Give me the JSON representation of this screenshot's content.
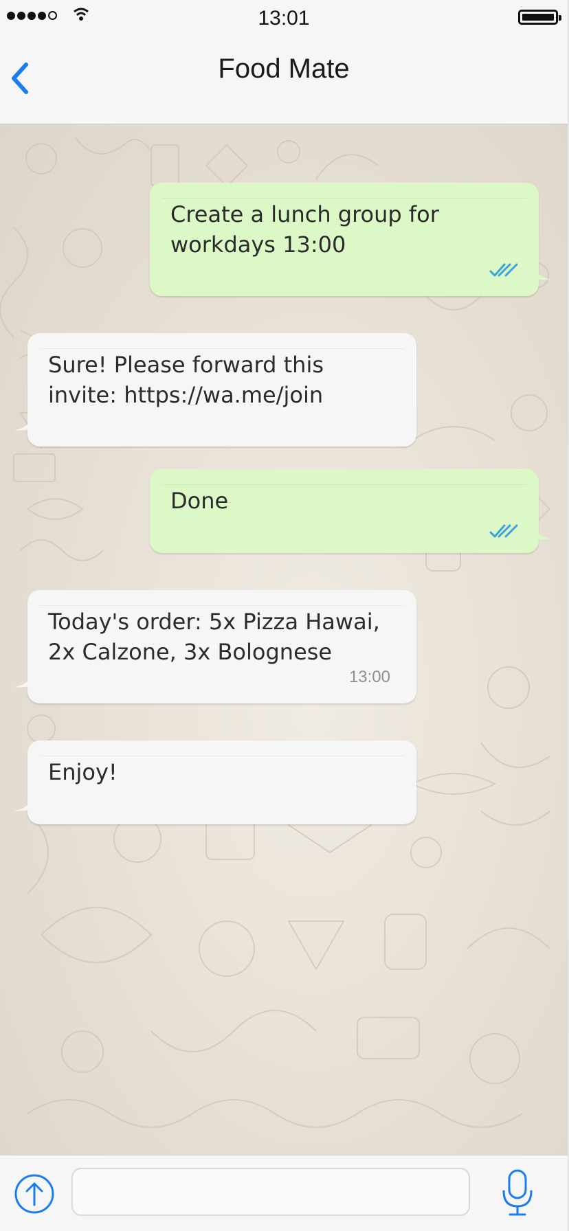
{
  "status_bar": {
    "time": "13:01",
    "signal_icon": "cellular-signal-icon",
    "wifi_icon": "wifi-icon",
    "battery_icon": "battery-icon",
    "battery_level": 1.0
  },
  "header": {
    "title": "Food Mate",
    "back_icon": "chevron-left-icon"
  },
  "messages": [
    {
      "direction": "outgoing",
      "text": "Create a lunch group for\nworkdays 13:00",
      "status_icon": "double-check-icon"
    },
    {
      "direction": "incoming",
      "text": "Sure! Please forward this\ninvite: https://wa.me/join"
    },
    {
      "direction": "outgoing",
      "text": "Done",
      "status_icon": "double-check-icon"
    },
    {
      "direction": "incoming",
      "text": "Today's order: 5x Pizza Hawai,\n2x Calzone, 3x Bolognese",
      "time": "13:00"
    },
    {
      "direction": "incoming",
      "text": "Enjoy!"
    }
  ],
  "composer": {
    "attach_icon": "up-arrow-circle-icon",
    "input_value": "",
    "input_placeholder": "",
    "mic_icon": "microphone-icon"
  },
  "colors": {
    "accent": "#1a7cf0",
    "outgoing_bubble": "#dcf8c6",
    "incoming_bubble": "#f6f6f6",
    "read_ticks": "#3aa3d8",
    "chat_background": "#e9e2d8"
  }
}
